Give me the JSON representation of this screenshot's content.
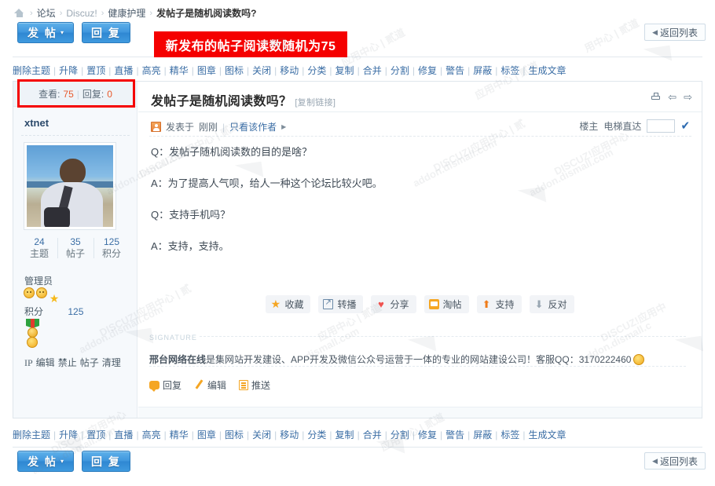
{
  "breadcrumb": {
    "home_icon": "home-icon",
    "items": [
      {
        "label": "论坛",
        "type": "link"
      },
      {
        "label": "Discuz!",
        "type": "link"
      },
      {
        "label": "健康护理",
        "type": "link"
      },
      {
        "label": "发帖子是随机阅读数吗?",
        "type": "current"
      }
    ],
    "separator": "›"
  },
  "toolbar": {
    "post_label": "发 帖",
    "post_caret": "▾",
    "reply_label": "回 复",
    "return_label": "返回列表",
    "return_arrow": "◀"
  },
  "annotation": {
    "text": "新发布的帖子阅读数随机为75",
    "bg_color": "#f50000",
    "text_color": "#ffffff",
    "highlight_border_color": "#f50000"
  },
  "mod_toolbar": {
    "items": [
      "删除主题",
      "升降",
      "置顶",
      "直播",
      "高亮",
      "精华",
      "图章",
      "图标",
      "关闭",
      "移动",
      "分类",
      "复制",
      "合并",
      "分割",
      "修复",
      "警告",
      "屏蔽",
      "标签",
      "生成文章"
    ],
    "separator": "|"
  },
  "post": {
    "viewcount": {
      "views_label": "查看:",
      "views_value": "75",
      "separator": "|",
      "replies_label": "回复:",
      "replies_value": "0"
    },
    "author": {
      "username": "xtnet",
      "avatar_alt": "user-avatar",
      "stats": [
        {
          "value": "24",
          "label": "主题"
        },
        {
          "value": "35",
          "label": "帖子"
        },
        {
          "value": "125",
          "label": "积分"
        }
      ],
      "group_name": "管理员",
      "medal_icons": [
        "smiley-medal-icon",
        "smiley-medal-icon",
        "star-medal-icon"
      ],
      "credit_label": "积分",
      "credit_value": "125",
      "rank_icons": [
        "ribbon-medal-icon",
        "gold-coin-icon"
      ],
      "side_links": [
        "IP",
        "编辑",
        "禁止",
        "帖子",
        "清理"
      ]
    },
    "title": "发帖子是随机阅读数吗？",
    "copy_link": "[复制链接]",
    "title_icons": [
      "print-icon",
      "prev-arrow-icon",
      "next-arrow-icon"
    ],
    "meta": {
      "author_icon": "author-badge-icon",
      "posted_prefix": "发表于",
      "posted_time": "刚刚",
      "separator": "|",
      "only_author": "只看该作者",
      "expand_caret": "▶"
    },
    "meta_right": {
      "floor_owner": "楼主",
      "jump_label": "电梯直达",
      "jump_value": "",
      "jump_placeholder": "",
      "go_icon": "go-arrow-icon"
    },
    "body": [
      "Q：发帖子随机阅读数的目的是啥？",
      "A：为了提高人气呗，给人一种这个论坛比较火吧。",
      "Q：支持手机吗？",
      "A：支持，支持。"
    ],
    "actions": [
      {
        "label": "收藏",
        "icon": "star-icon"
      },
      {
        "label": "转播",
        "icon": "relay-icon"
      },
      {
        "label": "分享",
        "icon": "heart-icon"
      },
      {
        "label": "淘帖",
        "icon": "collect-icon"
      },
      {
        "label": "支持",
        "icon": "thumbs-up-arrow-icon"
      },
      {
        "label": "反对",
        "icon": "thumbs-down-arrow-icon"
      }
    ],
    "signature": {
      "label": "SIGNATURE",
      "strong_text": "邢台网络在线",
      "text": "是集网站开发建设、APP开发及微信公众号运营于一体的专业的网站建设公司！客服QQ：3170222460",
      "smiley": "smiley-icon"
    },
    "post_links": [
      {
        "label": "回复",
        "icon": "speech-bubble-icon"
      },
      {
        "label": "编辑",
        "icon": "pencil-icon"
      },
      {
        "label": "推送",
        "icon": "push-icon"
      }
    ]
  },
  "watermarks": [
    "DISCUZ!应用中心 | 贰道",
    "addon.dismall.com"
  ]
}
